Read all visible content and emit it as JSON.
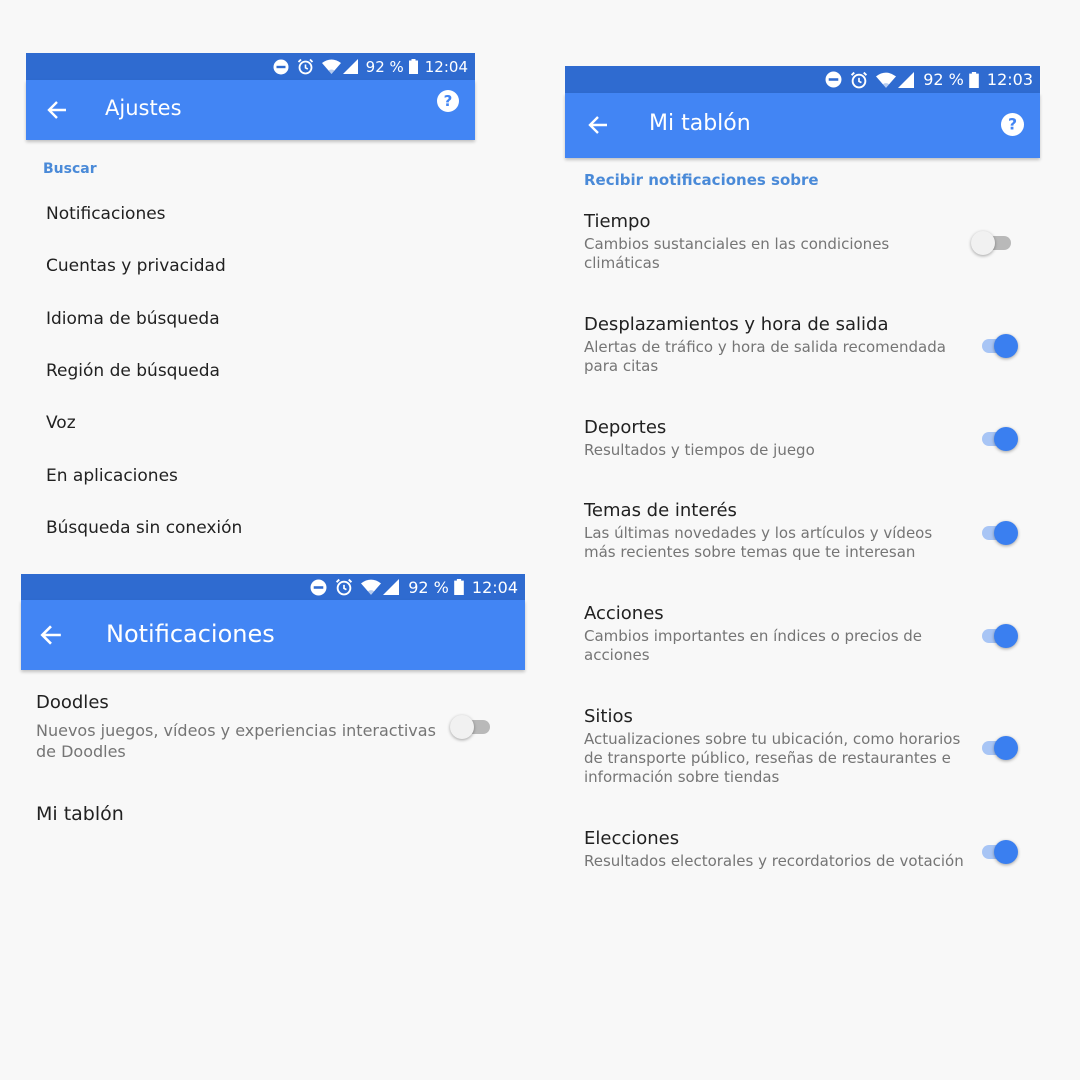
{
  "status_left": {
    "battery": "92 %",
    "time": "12:04"
  },
  "status_right": {
    "battery": "92 %",
    "time": "12:03"
  },
  "status_bottom": {
    "battery": "92 %",
    "time": "12:04"
  },
  "ajustes": {
    "title": "Ajustes",
    "section": "Buscar",
    "items": [
      "Notificaciones",
      "Cuentas y privacidad",
      "Idioma de búsqueda",
      "Región de búsqueda",
      "Voz",
      "En aplicaciones",
      "Búsqueda sin conexión"
    ]
  },
  "notificaciones": {
    "title": "Notificaciones",
    "doodles": {
      "title": "Doodles",
      "sub1": "Nuevos juegos, vídeos y experiencias interactivas",
      "sub2": "de Doodles",
      "enabled": false
    },
    "mi_tablon": "Mi tablón"
  },
  "mi_tablon": {
    "title": "Mi tablón",
    "section": "Recibir notificaciones sobre",
    "items": [
      {
        "title": "Tiempo",
        "lines": [
          "Cambios sustanciales en las condiciones",
          "climáticas"
        ],
        "enabled": false
      },
      {
        "title": "Desplazamientos y hora de salida",
        "lines": [
          "Alertas de tráfico y hora de salida recomendada",
          "para citas"
        ],
        "enabled": true
      },
      {
        "title": "Deportes",
        "lines": [
          "Resultados y tiempos de juego"
        ],
        "enabled": true
      },
      {
        "title": "Temas de interés",
        "lines": [
          "Las últimas novedades y los artículos y vídeos",
          "más recientes sobre temas que te interesan"
        ],
        "enabled": true
      },
      {
        "title": "Acciones",
        "lines": [
          "Cambios importantes en índices o precios de",
          "acciones"
        ],
        "enabled": true
      },
      {
        "title": "Sitios",
        "lines": [
          "Actualizaciones sobre tu ubicación, como horarios",
          "de transporte público, reseñas de restaurantes e",
          "información sobre tiendas"
        ],
        "enabled": true
      },
      {
        "title": "Elecciones",
        "lines": [
          "Resultados electorales y recordatorios de votación"
        ],
        "enabled": true
      }
    ]
  },
  "colors": {
    "status_bar": "#2f6bd0",
    "app_bar": "#4285f4",
    "accent": "#3a7ff0",
    "section_label": "#4a8ad8"
  }
}
